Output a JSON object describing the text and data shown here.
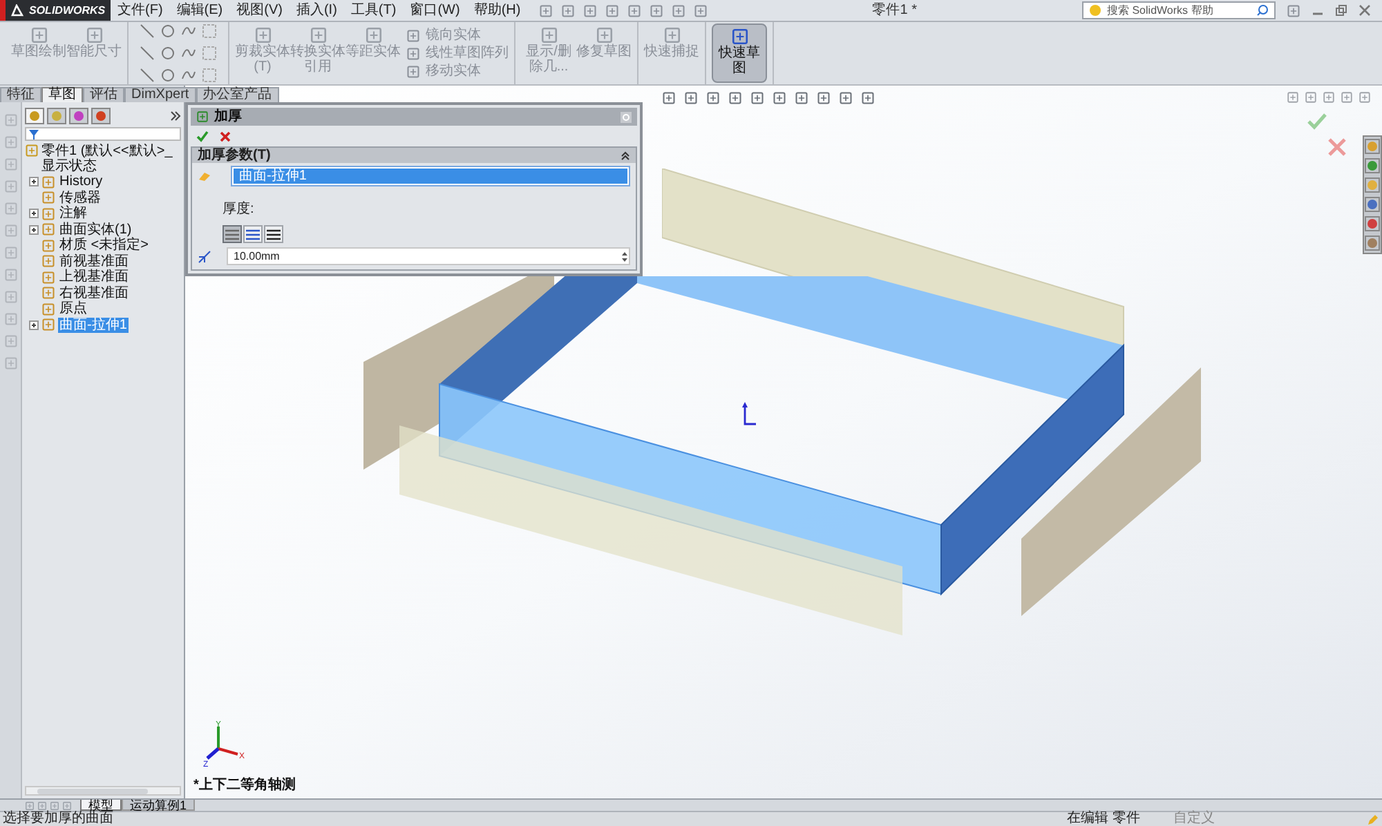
{
  "app": {
    "logo": "SOLIDWORKS"
  },
  "menu": [
    "文件(F)",
    "编辑(E)",
    "视图(V)",
    "插入(I)",
    "工具(T)",
    "窗口(W)",
    "帮助(H)"
  ],
  "title": "零件1 *",
  "search": {
    "placeholder": "搜索 SolidWorks 帮助"
  },
  "ribbon": [
    {
      "tools": [
        {
          "kind": "large",
          "label": "草图绘制",
          "selected": false
        },
        {
          "kind": "large",
          "label": "智能尺寸",
          "selected": false
        }
      ]
    },
    {
      "tools": [
        {
          "kind": "large",
          "label": "剪裁实体(T)",
          "selected": false
        },
        {
          "kind": "large",
          "label": "转换实体引用",
          "selected": false
        },
        {
          "kind": "large",
          "label": "等距实体",
          "selected": false
        },
        {
          "kind": "list",
          "items": [
            "镜向实体",
            "线性草图阵列",
            "移动实体"
          ]
        }
      ]
    },
    {
      "tools": [
        {
          "kind": "large",
          "label": "显示/删除几...",
          "selected": false
        },
        {
          "kind": "large",
          "label": "修复草图",
          "selected": false
        }
      ]
    },
    {
      "tools": [
        {
          "kind": "large",
          "label": "快速捕捉",
          "selected": false
        }
      ]
    },
    {
      "tools": [
        {
          "kind": "large",
          "label": "快速草图",
          "selected": true
        }
      ]
    }
  ],
  "tabs": [
    {
      "label": "特征",
      "selected": false
    },
    {
      "label": "草图",
      "selected": true
    },
    {
      "label": "评估",
      "selected": false
    },
    {
      "label": "DimXpert",
      "selected": false
    },
    {
      "label": "办公室产品",
      "selected": false
    }
  ],
  "tree": {
    "root": "零件1 (默认<<默认>_显示状态",
    "items": [
      {
        "label": "History",
        "expandable": true,
        "selected": false
      },
      {
        "label": "传感器",
        "expandable": false,
        "selected": false
      },
      {
        "label": "注解",
        "expandable": true,
        "selected": false
      },
      {
        "label": "曲面实体(1)",
        "expandable": true,
        "selected": false
      },
      {
        "label": "材质 <未指定>",
        "expandable": false,
        "selected": false
      },
      {
        "label": "前视基准面",
        "expandable": false,
        "selected": false
      },
      {
        "label": "上视基准面",
        "expandable": false,
        "selected": false
      },
      {
        "label": "右视基准面",
        "expandable": false,
        "selected": false
      },
      {
        "label": "原点",
        "expandable": false,
        "selected": false
      },
      {
        "label": "曲面-拉伸1",
        "expandable": true,
        "selected": true
      }
    ]
  },
  "property_manager": {
    "title": "加厚",
    "section": "加厚参数(T)",
    "selection": [
      {
        "label": "曲面-拉伸1",
        "selected": true
      }
    ],
    "thickness_label": "厚度:",
    "sides": [
      {
        "selected": true
      },
      {
        "selected": false
      },
      {
        "selected": false
      }
    ],
    "value": "10.00mm"
  },
  "view": {
    "orientation": "*上下二等角轴测",
    "triad": {
      "x": "X",
      "y": "Y",
      "z": "Z"
    }
  },
  "bottom_tabs": [
    {
      "label": "模型",
      "selected": true
    },
    {
      "label": "运动算例1",
      "selected": false
    }
  ],
  "status_bar": {
    "message": "选择要加厚的曲面",
    "mode": "在编辑 零件",
    "units": "自定义"
  }
}
